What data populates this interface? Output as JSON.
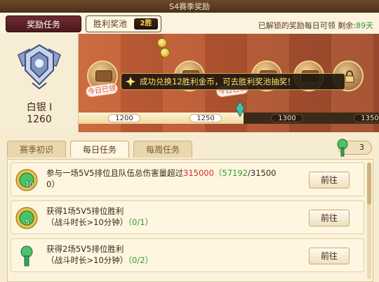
{
  "window": {
    "title": "S4赛季奖励"
  },
  "top": {
    "tab_tasks": "奖励任务",
    "tab_pool": "胜利奖池",
    "pool_badge": "2胜",
    "unlock_prefix": "已解锁的奖励每日可领 剩余:",
    "unlock_days": "89天"
  },
  "rank": {
    "name": "白银 I",
    "score": "1260"
  },
  "track": {
    "toast": "成功兑换12胜利金币，可去胜利奖池抽奖！",
    "claimed_label": "今日已领",
    "ticks": [
      "1200",
      "1250",
      "1300",
      "1350"
    ],
    "progress_fraction": 0.55
  },
  "subtabs": {
    "rookie": "赛季初识",
    "daily": "每日任务",
    "weekly": "每周任务"
  },
  "currency": {
    "count": "3"
  },
  "tasks": [
    {
      "line1_prefix": "参与一场5V5排位且队伍总伤害量超过",
      "target": "315000",
      "paren_open": "（",
      "current": "57192",
      "slash_total": "/31500",
      "line2": "0）",
      "icon_count": "10",
      "button": "前往"
    },
    {
      "line1": "获得1场5V5排位胜利",
      "line2_prefix": "（战斗时长>10分钟）",
      "progress": "（0/1）",
      "icon_count": "5",
      "button": "前往"
    },
    {
      "line1": "获得2场5V5排位胜利",
      "line2_prefix": "（战斗时长>10分钟）",
      "progress": "（0/2）",
      "button": "前往"
    }
  ],
  "colors": {
    "accent": "#6e2a2e",
    "gold": "#ffd84a",
    "progress": "#2f9a2f",
    "target": "#d42a2a"
  },
  "icons": [
    "silver-rank-emblem-icon",
    "chest-icon",
    "lock-icon",
    "coin-icon",
    "gem-key-icon",
    "badge-icon"
  ]
}
